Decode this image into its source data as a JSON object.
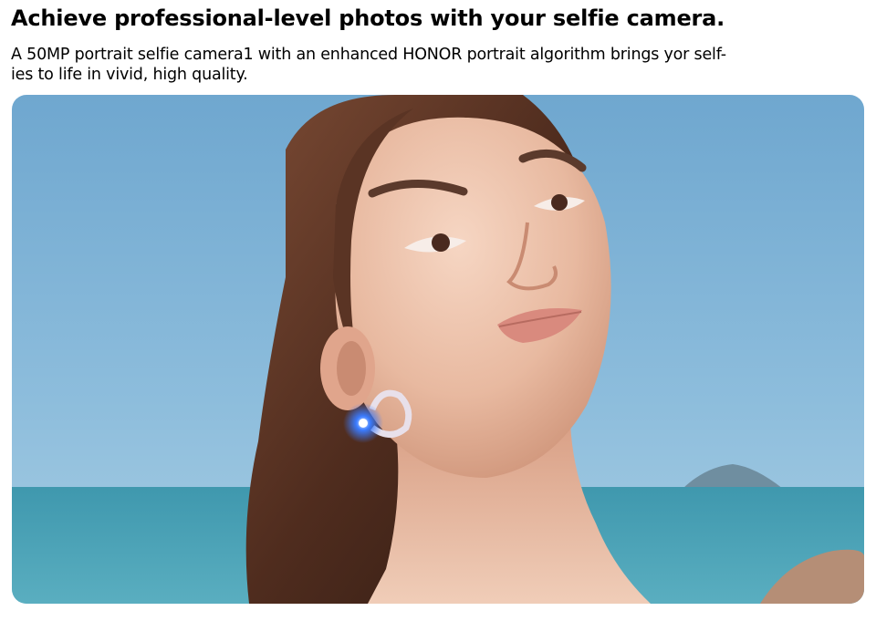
{
  "content": {
    "headline": "Achieve professional-level photos with your selfie camera.",
    "description_line1": "A 50MP portrait selfie camera1 with an enhanced HONOR portrait algorithm brings yor self-",
    "description_line2": "ies to life in vivid, high quality."
  },
  "colors": {
    "sky": "#7ab0d3",
    "sea": "#3f98ae",
    "hair": "#5a3424",
    "skin": "#e9bfa8",
    "lips": "#d98a7e",
    "earring_glow": "#3a7bff"
  }
}
